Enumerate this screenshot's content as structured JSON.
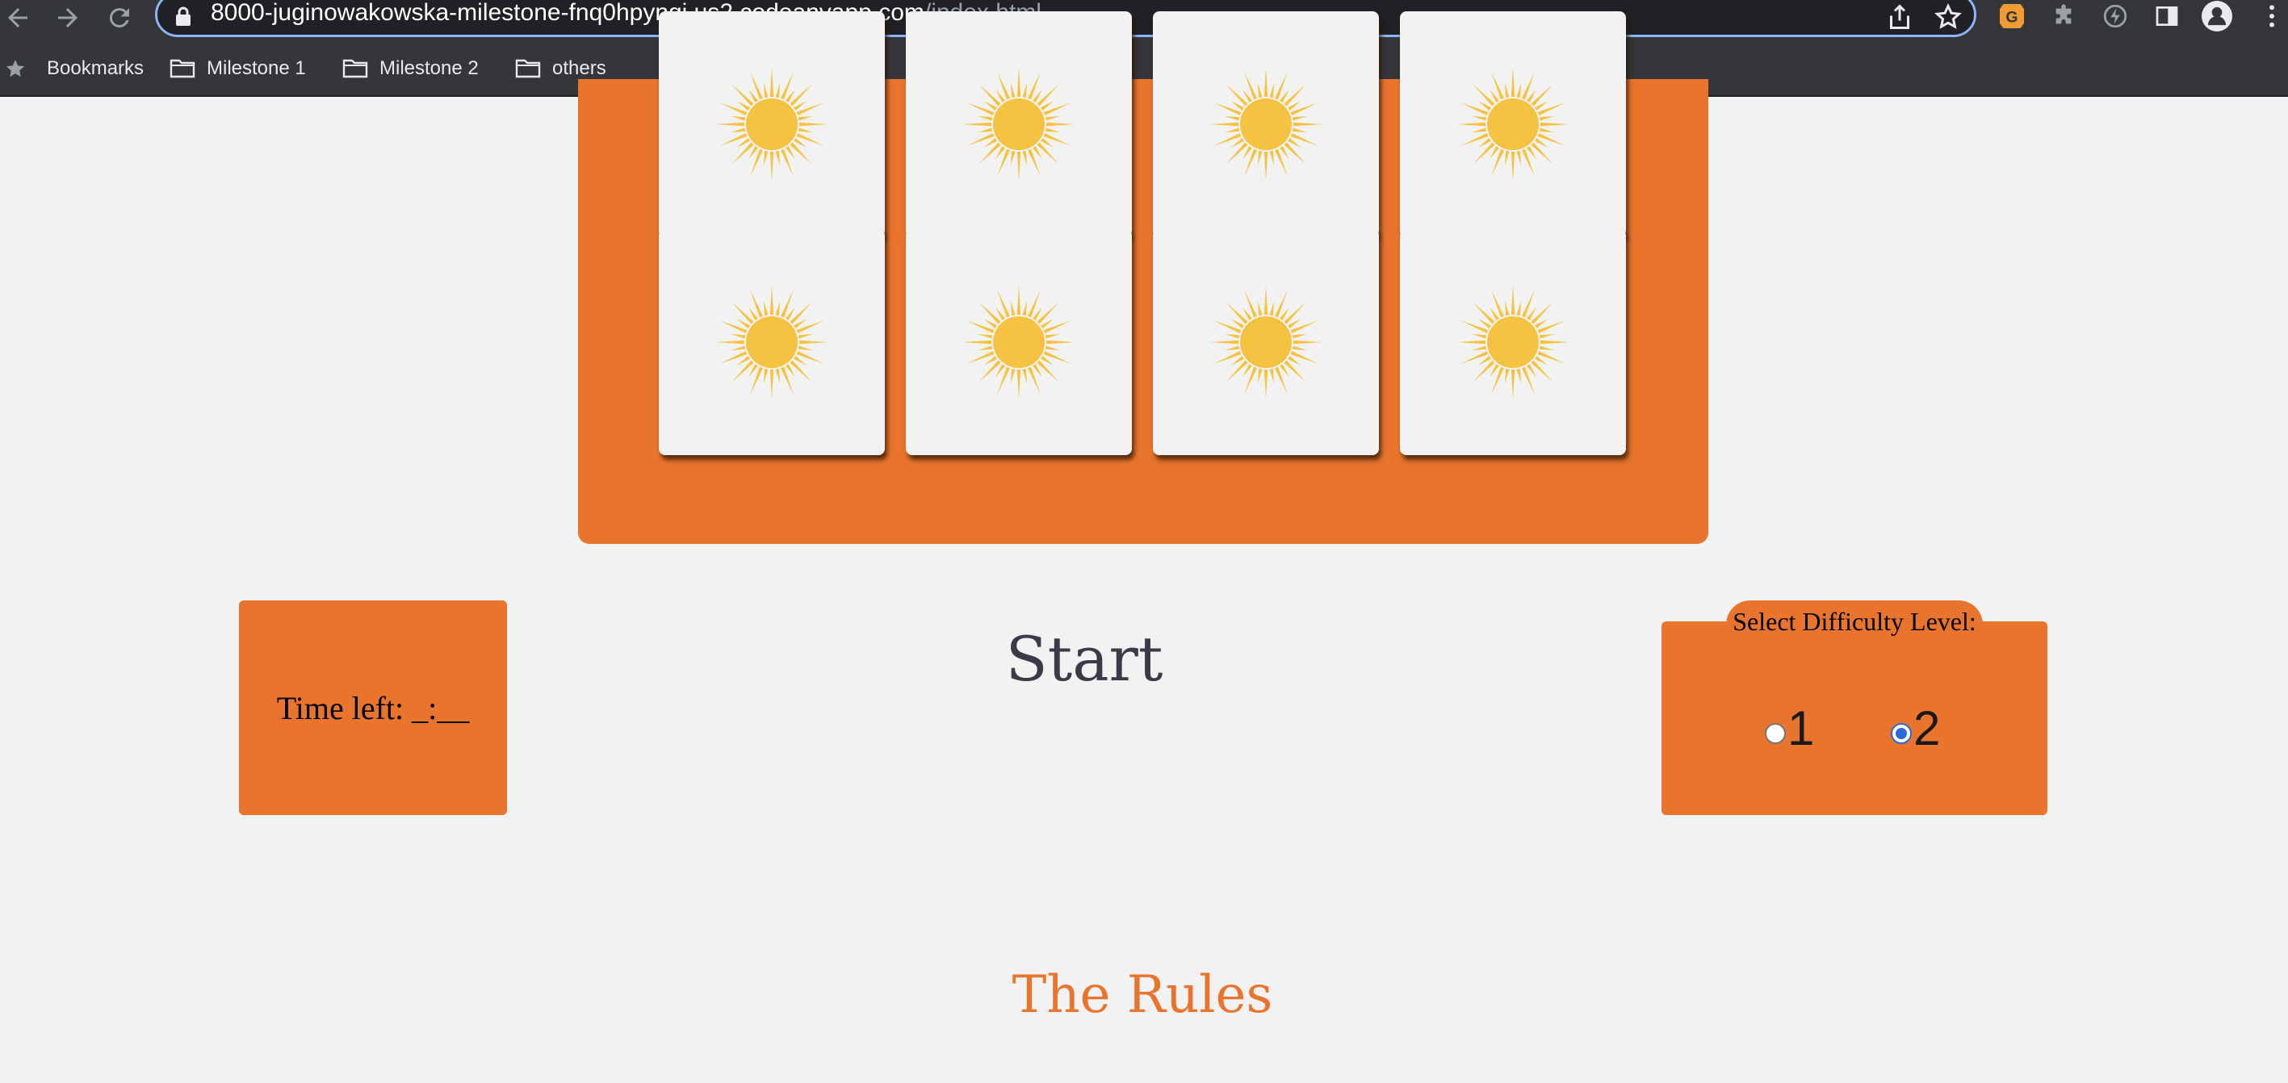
{
  "browser": {
    "url_host": "8000-juginowakowska-milestone-fnq0hpynqj.us2.codeanyapp.com",
    "url_path": "/index.html",
    "bookmarks": [
      {
        "label": "Bookmarks",
        "icon": "star-icon"
      },
      {
        "label": "Milestone 1",
        "icon": "folder-icon"
      },
      {
        "label": "Milestone 2",
        "icon": "folder-icon"
      },
      {
        "label": "others",
        "icon": "folder-icon"
      }
    ]
  },
  "game": {
    "cards": [
      {
        "row": 1,
        "col": 1,
        "face": "sun-icon"
      },
      {
        "row": 1,
        "col": 2,
        "face": "sun-icon"
      },
      {
        "row": 1,
        "col": 3,
        "face": "sun-icon"
      },
      {
        "row": 1,
        "col": 4,
        "face": "sun-icon"
      },
      {
        "row": 2,
        "col": 1,
        "face": "sun-icon"
      },
      {
        "row": 2,
        "col": 2,
        "face": "sun-icon"
      },
      {
        "row": 2,
        "col": 3,
        "face": "sun-icon"
      },
      {
        "row": 2,
        "col": 4,
        "face": "sun-icon"
      }
    ],
    "timer_text": "Time left: _:__",
    "start_label": "Start",
    "difficulty": {
      "legend": "Select Difficulty Level:",
      "options": [
        "1",
        "2"
      ],
      "selected": "2"
    },
    "rules_heading": "The Rules"
  },
  "colors": {
    "accent": "#e8742e",
    "background": "#f2f2f2",
    "sun": "#f5c242",
    "chrome": "#35363a"
  }
}
